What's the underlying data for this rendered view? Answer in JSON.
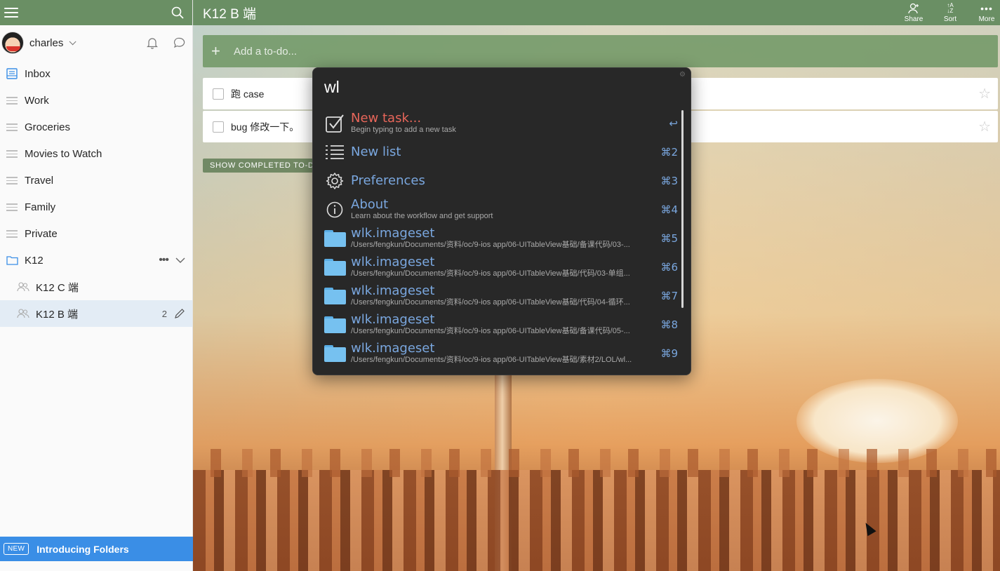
{
  "sidebar": {
    "user": {
      "name": "charles"
    },
    "items": [
      {
        "label": "Inbox"
      },
      {
        "label": "Work"
      },
      {
        "label": "Groceries"
      },
      {
        "label": "Movies to Watch"
      },
      {
        "label": "Travel"
      },
      {
        "label": "Family"
      },
      {
        "label": "Private"
      },
      {
        "label": "K12"
      },
      {
        "label": "K12 C 端"
      },
      {
        "label": "K12 B 端",
        "count": "2"
      }
    ],
    "promo": {
      "badge": "NEW",
      "text": "Introducing Folders"
    }
  },
  "header": {
    "title": "K12 B 端",
    "actions": [
      {
        "label": "Share"
      },
      {
        "label": "Sort"
      },
      {
        "label": "More"
      }
    ]
  },
  "main": {
    "add_placeholder": "Add a to-do...",
    "tasks": [
      {
        "text": "跑 case"
      },
      {
        "text": "bug 修改一下。"
      }
    ],
    "show_completed": "SHOW COMPLETED TO-D"
  },
  "launcher": {
    "query": "wl",
    "results": [
      {
        "title": "New task...",
        "subtitle": "Begin typing to add a new task",
        "key": "↩"
      },
      {
        "title": "New list",
        "subtitle": "",
        "key": "⌘2"
      },
      {
        "title": "Preferences",
        "subtitle": "",
        "key": "⌘3"
      },
      {
        "title": "About",
        "subtitle": "Learn about the workflow and get support",
        "key": "⌘4"
      },
      {
        "title": "wlk.imageset",
        "subtitle": "/Users/fengkun/Documents/资料/oc/9-ios app/06-UITableView基础/备课代码/03-...",
        "key": "⌘5"
      },
      {
        "title": "wlk.imageset",
        "subtitle": "/Users/fengkun/Documents/资料/oc/9-ios app/06-UITableView基础/代码/03-单组...",
        "key": "⌘6"
      },
      {
        "title": "wlk.imageset",
        "subtitle": "/Users/fengkun/Documents/资料/oc/9-ios app/06-UITableView基础/代码/04-循环...",
        "key": "⌘7"
      },
      {
        "title": "wlk.imageset",
        "subtitle": "/Users/fengkun/Documents/资料/oc/9-ios app/06-UITableView基础/备课代码/05-...",
        "key": "⌘8"
      },
      {
        "title": "wlk.imageset",
        "subtitle": "/Users/fengkun/Documents/资料/oc/9-ios app/06-UITableView基础/素材2/LOL/wl...",
        "key": "⌘9"
      }
    ]
  },
  "colors": {
    "accent_green": "#6a8f64",
    "promo_blue": "#3a8ee6",
    "result_blue": "#7aa7df",
    "result_red": "#e8665a"
  }
}
